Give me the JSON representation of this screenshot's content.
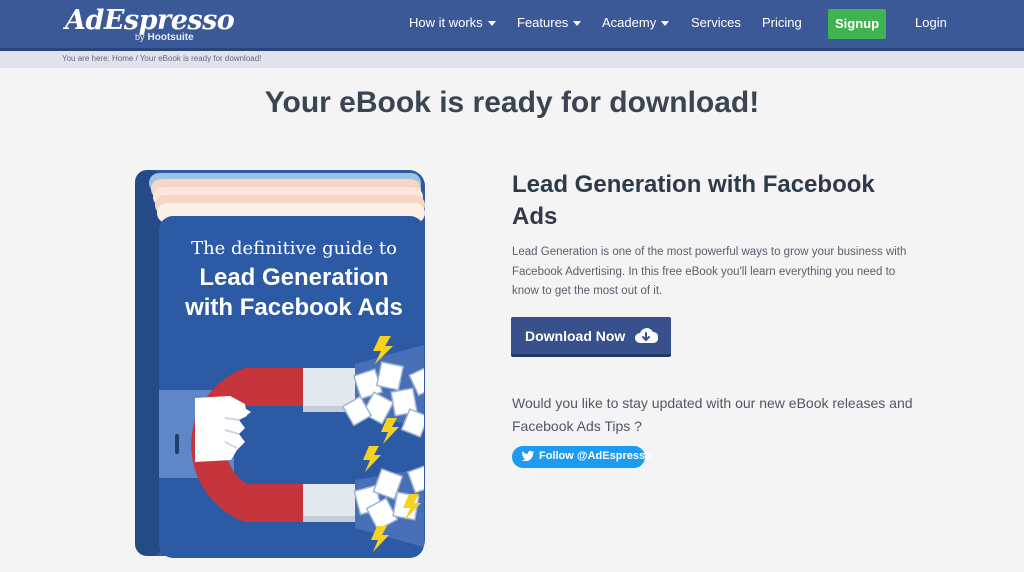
{
  "brand": {
    "logo_text": "AdEspresso",
    "by_text": "by",
    "partner": "Hootsuite"
  },
  "nav": {
    "items": [
      {
        "label": "How it works",
        "dropdown": true
      },
      {
        "label": "Features",
        "dropdown": true
      },
      {
        "label": "Academy",
        "dropdown": true
      },
      {
        "label": "Services",
        "dropdown": false
      },
      {
        "label": "Pricing",
        "dropdown": false
      }
    ],
    "signup": "Signup",
    "login": "Login"
  },
  "breadcrumb": "You are here: Home / Your eBook is ready for download!",
  "page_title": "Your eBook is ready for download!",
  "book": {
    "line1": "The definitive guide to",
    "line2": "Lead Generation",
    "line3": "with Facebook Ads"
  },
  "ebook": {
    "heading": "Lead Generation with Facebook Ads",
    "description": "Lead Generation is one of the most powerful ways to grow your business with Facebook Advertising. In this free eBook you'll learn everything you need to know to get the most out of it.",
    "download_label": "Download Now",
    "updates_text": "Would you like to stay updated with our new eBook releases and Facebook Ads Tips ?",
    "twitter_label": "Follow @AdEspresso"
  },
  "colors": {
    "header": "#3c5997",
    "signup": "#3fb34f",
    "download": "#38518c",
    "twitter": "#1d9bf0",
    "book_cover": "#2c5aa4"
  },
  "icons": {
    "download": "cloud-download-icon",
    "twitter": "twitter-bird-icon",
    "caret": "caret-down-icon"
  }
}
